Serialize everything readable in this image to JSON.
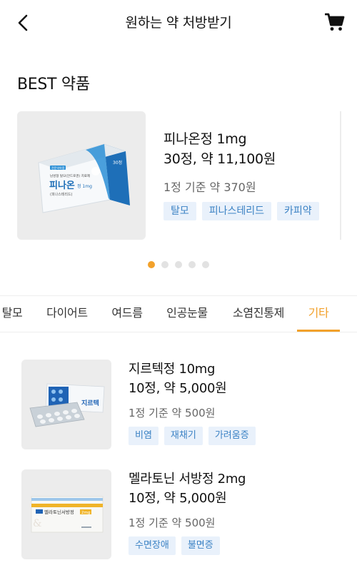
{
  "header": {
    "title": "원하는 약 처방받기",
    "back_icon": "chevron-left-icon",
    "cart_icon": "cart-icon"
  },
  "best_section": {
    "title": "BEST 약품",
    "product": {
      "name": "피나온정 1mg",
      "price": "30정, 약 11,100원",
      "unit_price": "1정 기준 약 370원",
      "tags": [
        "탈모",
        "피나스테리드",
        "카피약"
      ],
      "package": {
        "brand": "피나온",
        "strength": "정 1mg",
        "badge": "30정",
        "label_top": "전문의약품",
        "subtitle": "남성형 탈모(안드로겐) 치료제",
        "ingredient": "(피나스테리드)"
      }
    },
    "carousel": {
      "count": 5,
      "active_index": 0
    }
  },
  "tabs": {
    "items": [
      "탈모",
      "다이어트",
      "여드름",
      "인공눈물",
      "소염진통제",
      "기타"
    ],
    "active_index": 5
  },
  "products": [
    {
      "name": "지르텍정 10mg",
      "price": "10정, 약 5,000원",
      "unit_price": "1정 기준 약 500원",
      "tags": [
        "비염",
        "재채기",
        "가려움증"
      ],
      "package_label": "지르텍"
    },
    {
      "name": "멜라토닌 서방정 2mg",
      "price": "10정, 약 5,000원",
      "unit_price": "1정 기준 약 500원",
      "tags": [
        "수면장애",
        "불면증"
      ],
      "package_label": "멜라토닌서방정",
      "package_badge": "2mg"
    }
  ],
  "colors": {
    "accent": "#f2a12b",
    "tag_bg": "#e9f1fb",
    "tag_text": "#3b82c4",
    "thumb_bg": "#ececec"
  }
}
